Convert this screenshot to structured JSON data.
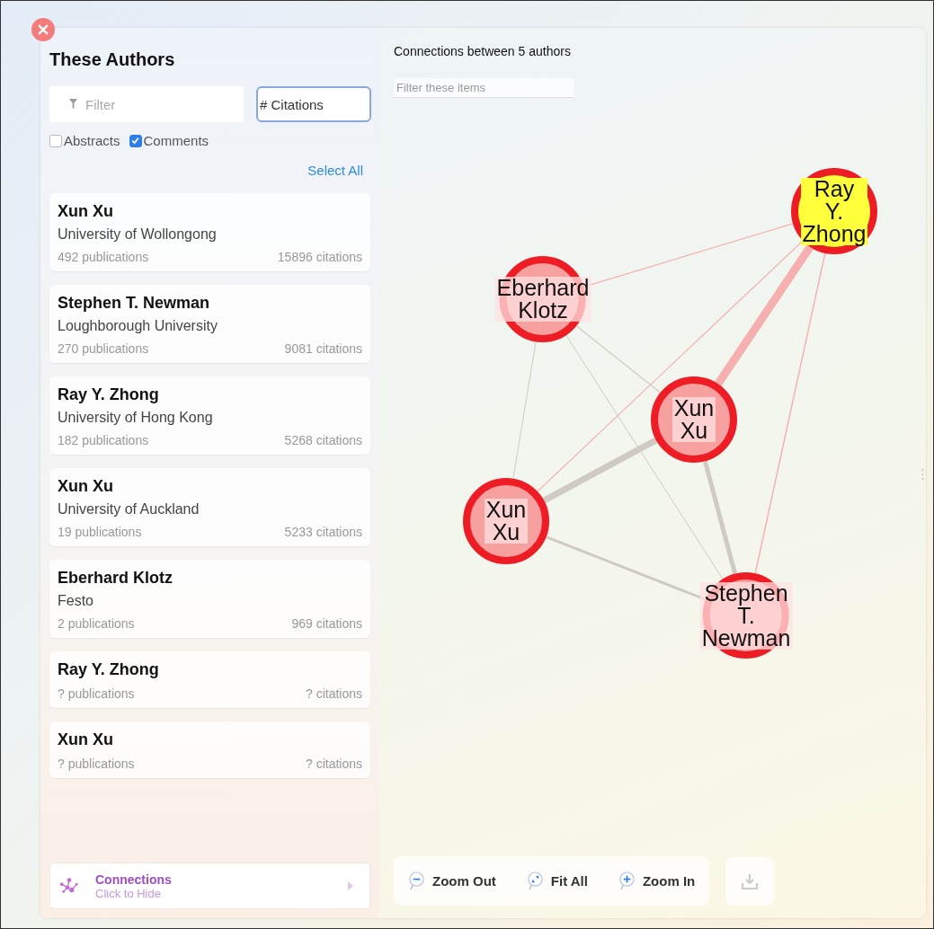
{
  "authors_panel": {
    "title": "These Authors",
    "filter": {
      "placeholder": "Filter"
    },
    "sort_field": {
      "value": "# Citations"
    },
    "options": [
      {
        "label": "Abstracts",
        "checked": false
      },
      {
        "label": "Comments",
        "checked": true
      }
    ],
    "select_all": "Select All",
    "authors": [
      {
        "name": "Xun Xu",
        "affiliation": "University of Wollongong",
        "publications": "492 publications",
        "citations": "15896 citations"
      },
      {
        "name": "Stephen T. Newman",
        "affiliation": "Loughborough University",
        "publications": "270 publications",
        "citations": "9081 citations"
      },
      {
        "name": "Ray Y. Zhong",
        "affiliation": "University of Hong Kong",
        "publications": "182 publications",
        "citations": "5268 citations"
      },
      {
        "name": "Xun Xu",
        "affiliation": "University of Auckland",
        "publications": "19 publications",
        "citations": "5233 citations"
      },
      {
        "name": "Eberhard Klotz",
        "affiliation": "Festo",
        "publications": "2 publications",
        "citations": "969 citations"
      },
      {
        "name": "Ray Y. Zhong",
        "publications": "? publications",
        "citations": "? citations"
      },
      {
        "name": "Xun Xu",
        "publications": "? publications",
        "citations": "? citations"
      }
    ],
    "connections": {
      "title": "Connections",
      "subtitle": "Click to Hide"
    }
  },
  "graph": {
    "title": "Connections between 5 authors",
    "filter": {
      "placeholder": "Filter these items"
    },
    "nodes": [
      {
        "label": "Ray Y. Zhong",
        "selected": true
      },
      {
        "label": "Eberhard Klotz",
        "selected": false
      },
      {
        "label": "Xun Xu",
        "selected": false
      },
      {
        "label": "Xun Xu",
        "selected": false
      },
      {
        "label": "Stephen T. Newman",
        "selected": false
      }
    ],
    "toolbar": [
      {
        "kind": "zoom-out",
        "label": "Zoom Out"
      },
      {
        "kind": "fit",
        "label": "Fit All"
      },
      {
        "kind": "zoom-in",
        "label": "Zoom In"
      }
    ]
  }
}
